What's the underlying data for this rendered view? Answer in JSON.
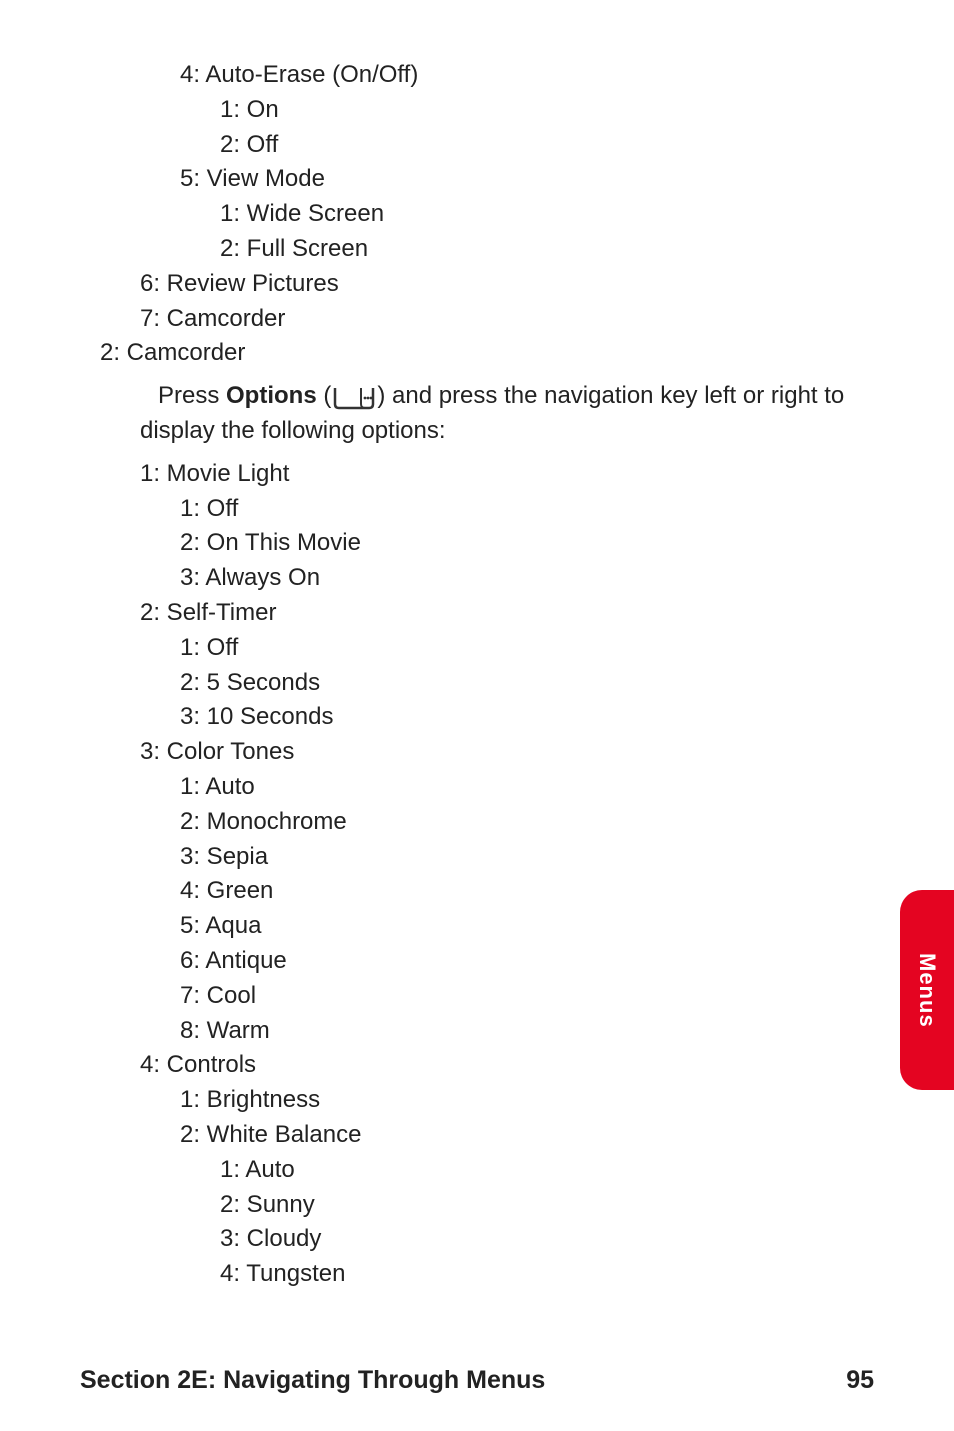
{
  "menu": {
    "autoErase": {
      "label": "4: Auto-Erase (On/Off)",
      "on": "1: On",
      "off": "2: Off"
    },
    "viewMode": {
      "label": "5: View Mode",
      "wide": "1: Wide Screen",
      "full": "2: Full Screen"
    },
    "reviewPictures": "6: Review Pictures",
    "camcorder7": "7: Camcorder",
    "camcorder2": "2: Camcorder",
    "paragraph": {
      "pre": "Press ",
      "options": "Options",
      "post": " (",
      "close": ")  and press the navigation key left or right to display the following options:"
    },
    "movieLight": {
      "label": "1: Movie Light",
      "off": "1: Off",
      "onThis": "2: On This Movie",
      "always": "3: Always On"
    },
    "selfTimer": {
      "label": "2: Self-Timer",
      "off": "1: Off",
      "five": "2: 5 Seconds",
      "ten": "3: 10 Seconds"
    },
    "colorTones": {
      "label": "3: Color Tones",
      "auto": "1: Auto",
      "mono": "2: Monochrome",
      "sepia": "3: Sepia",
      "green": "4: Green",
      "aqua": "5: Aqua",
      "antique": "6: Antique",
      "cool": "7: Cool",
      "warm": "8: Warm"
    },
    "controls": {
      "label": "4: Controls",
      "brightness": "1: Brightness",
      "whiteBalance": {
        "label": "2: White Balance",
        "auto": "1: Auto",
        "sunny": "2: Sunny",
        "cloudy": "3: Cloudy",
        "tungsten": "4: Tungsten"
      }
    }
  },
  "sideTab": "Menus",
  "footer": {
    "section": "Section 2E: Navigating Through Menus",
    "page": "95"
  }
}
